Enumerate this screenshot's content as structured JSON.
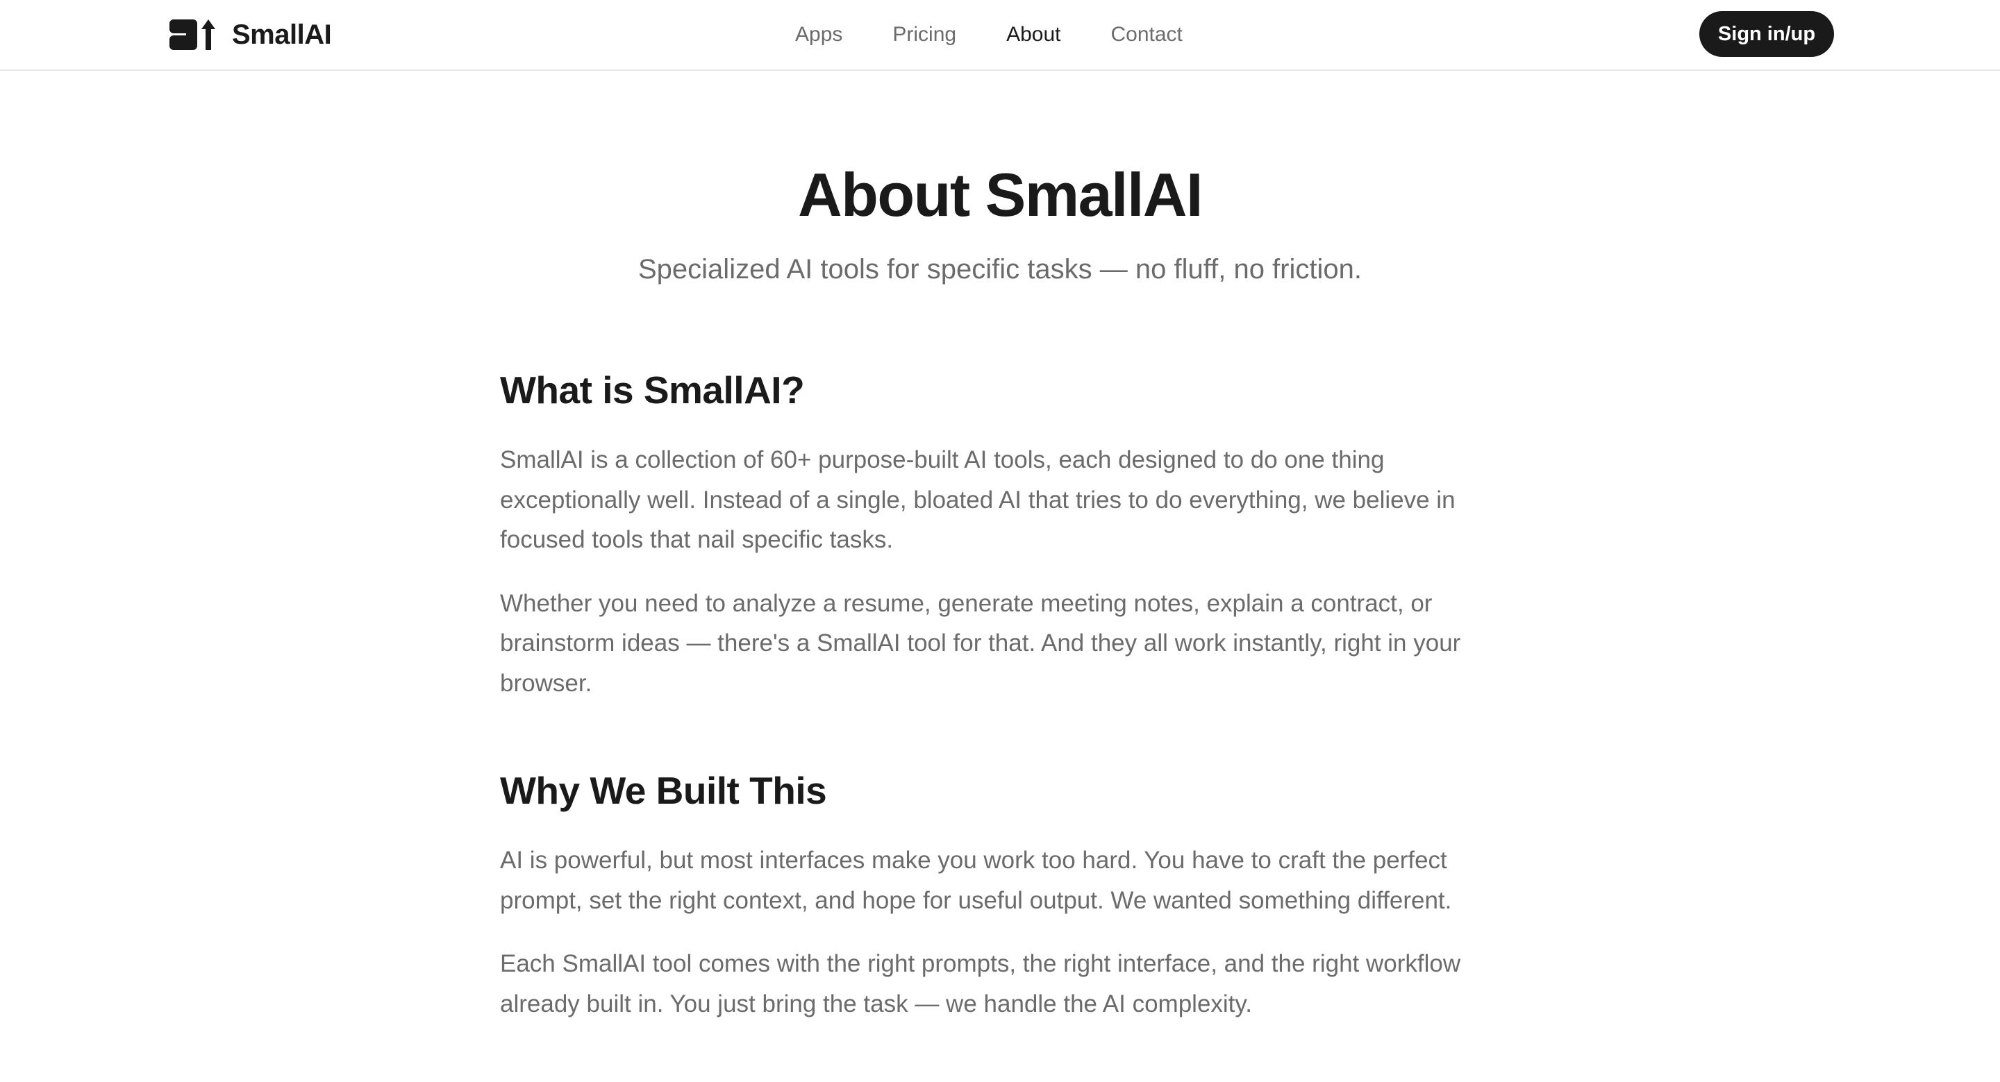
{
  "header": {
    "brand": "SmallAI",
    "logo_icon": "smallai-logo-icon",
    "nav": [
      {
        "label": "Apps",
        "active": false
      },
      {
        "label": "Pricing",
        "active": false
      },
      {
        "label": "About",
        "active": true
      },
      {
        "label": "Contact",
        "active": false
      }
    ],
    "signin_label": "Sign in/up"
  },
  "hero": {
    "title": "About SmallAI",
    "subtitle": "Specialized AI tools for specific tasks — no fluff, no friction."
  },
  "sections": [
    {
      "heading": "What is SmallAI?",
      "paragraphs": [
        "SmallAI is a collection of 60+ purpose-built AI tools, each designed to do one thing exceptionally well. Instead of a single, bloated AI that tries to do everything, we believe in focused tools that nail specific tasks.",
        "Whether you need to analyze a resume, generate meeting notes, explain a contract, or brainstorm ideas — there's a SmallAI tool for that. And they all work instantly, right in your browser."
      ]
    },
    {
      "heading": "Why We Built This",
      "paragraphs": [
        "AI is powerful, but most interfaces make you work too hard. You have to craft the perfect prompt, set the right context, and hope for useful output. We wanted something different.",
        "Each SmallAI tool comes with the right prompts, the right interface, and the right workflow already built in. You just bring the task — we handle the AI complexity."
      ]
    }
  ],
  "colors": {
    "text_primary": "#1a1a1a",
    "text_secondary": "#6b6b6b",
    "button_bg": "#1a1a1a",
    "button_text": "#ffffff",
    "divider": "#e8e8e8"
  }
}
